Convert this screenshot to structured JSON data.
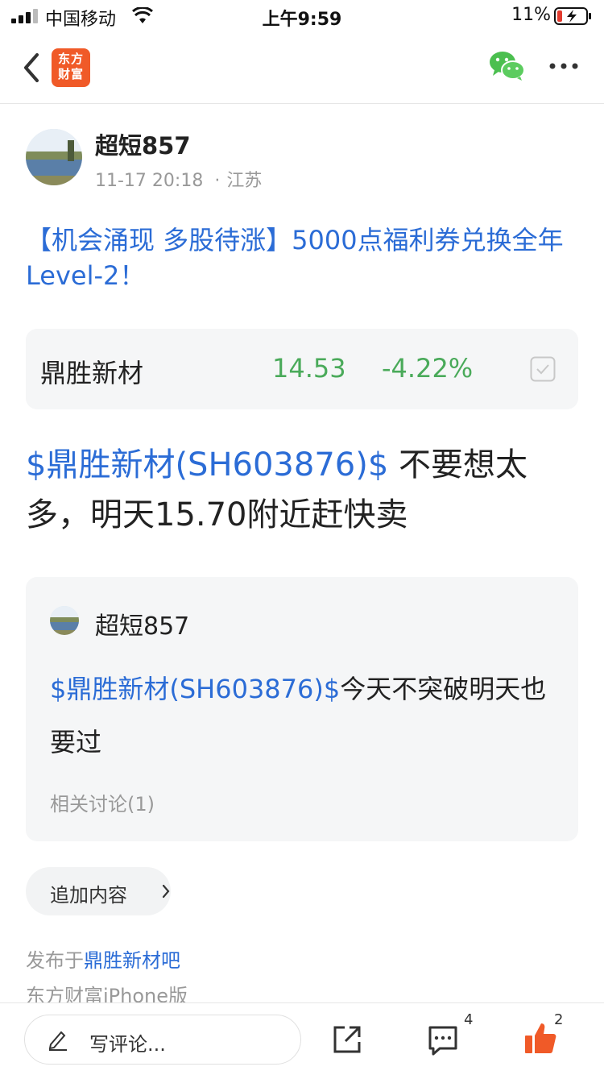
{
  "status_bar": {
    "carrier": "中国移动",
    "time": "上午9:59",
    "battery": "11%"
  },
  "nav": {
    "logo_line1": "东方",
    "logo_line2": "财富",
    "icons": [
      "back-icon",
      "wechat-share-icon",
      "more-icon"
    ],
    "logo_color": "#f05a28"
  },
  "author": {
    "name": "超短857",
    "datetime": "11-17 20:18",
    "dot": "·",
    "location": "江苏"
  },
  "post": {
    "title": "【机会涌现 多股待涨】5000点福利券兑换全年Level-2！",
    "body_link": "$鼎胜新材(SH603876)$",
    "body_text": " 不要想太多，明天15.70附近赶快卖"
  },
  "stock_card": {
    "name": "鼎胜新材",
    "price": "14.53",
    "change": "-4.22%",
    "change_color": "#4aaa5a",
    "watch_icon": "checkbox-icon"
  },
  "quote": {
    "author": "超短857",
    "link": "$鼎胜新材(SH603876)$",
    "text": "今天不突破明天也要过",
    "related": "相关讨论(1)"
  },
  "append_button": {
    "label": "追加内容"
  },
  "footer_meta": {
    "published_prefix": "发布于",
    "published_link": "鼎胜新材吧",
    "client": "东方财富iPhone版"
  },
  "bottom_bar": {
    "comment_placeholder": "写评论...",
    "comment_count": "4",
    "like_count": "2",
    "like_color": "#f05a28"
  },
  "colors": {
    "link": "#2b6cd6",
    "card_bg": "#f5f6f7"
  }
}
